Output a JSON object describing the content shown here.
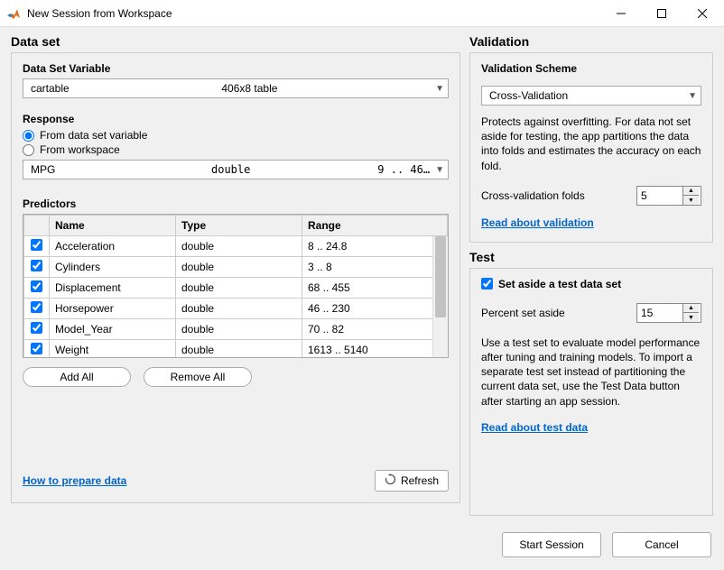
{
  "window": {
    "title": "New Session from Workspace"
  },
  "left": {
    "title": "Data set",
    "dataset_label": "Data Set Variable",
    "dataset_value": "cartable",
    "dataset_meta": "406x8 table",
    "response_label": "Response",
    "response_from_var": "From data set variable",
    "response_from_ws": "From workspace",
    "response_value": "MPG",
    "response_type": "double",
    "response_range": "9 .. 46…",
    "predictors_label": "Predictors",
    "col_name": "Name",
    "col_type": "Type",
    "col_range": "Range",
    "rows": [
      {
        "name": "Acceleration",
        "type": "double",
        "range": "8 .. 24.8"
      },
      {
        "name": "Cylinders",
        "type": "double",
        "range": "3 .. 8"
      },
      {
        "name": "Displacement",
        "type": "double",
        "range": "68 .. 455"
      },
      {
        "name": "Horsepower",
        "type": "double",
        "range": "46 .. 230"
      },
      {
        "name": "Model_Year",
        "type": "double",
        "range": "70 .. 82"
      },
      {
        "name": "Weight",
        "type": "double",
        "range": "1613 .. 5140"
      }
    ],
    "add_all": "Add All",
    "remove_all": "Remove All",
    "prepare_link": "How to prepare data",
    "refresh": "Refresh"
  },
  "validation": {
    "title": "Validation",
    "scheme_label": "Validation Scheme",
    "scheme_value": "Cross-Validation",
    "desc": "Protects against overfitting. For data not set aside for testing, the app partitions the data into folds and estimates the accuracy on each fold.",
    "folds_label": "Cross-validation folds",
    "folds_value": "5",
    "link": "Read about validation"
  },
  "test": {
    "title": "Test",
    "set_aside_label": "Set aside a test data set",
    "percent_label": "Percent set aside",
    "percent_value": "15",
    "desc": "Use a test set to evaluate model performance after tuning and training models. To import a separate test set instead of partitioning the current data set, use the Test Data button after starting an app session.",
    "link": "Read about test data"
  },
  "footer": {
    "start": "Start Session",
    "cancel": "Cancel"
  }
}
